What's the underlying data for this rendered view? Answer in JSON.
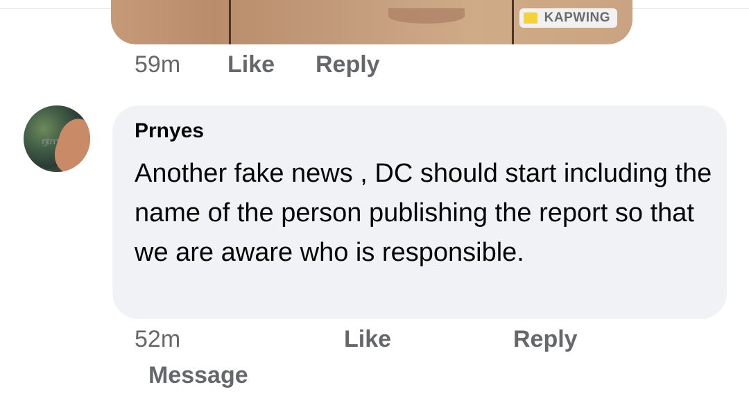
{
  "previous_comment": {
    "watermark_text": "KAPWING",
    "time": "59m",
    "like_label": "Like",
    "reply_label": "Reply"
  },
  "comment": {
    "author": "Prnyes",
    "text": "Another fake news , DC should start including the name of the person publishing the report so that we are aware who is responsible.",
    "time": "52m",
    "like_label": "Like",
    "reply_label": "Reply",
    "message_label": "Message",
    "bubble_color": "#f0f2f5"
  },
  "colors": {
    "secondary_text": "#65676b",
    "primary_text": "#050505",
    "watermark_accent": "#f3d23c"
  }
}
